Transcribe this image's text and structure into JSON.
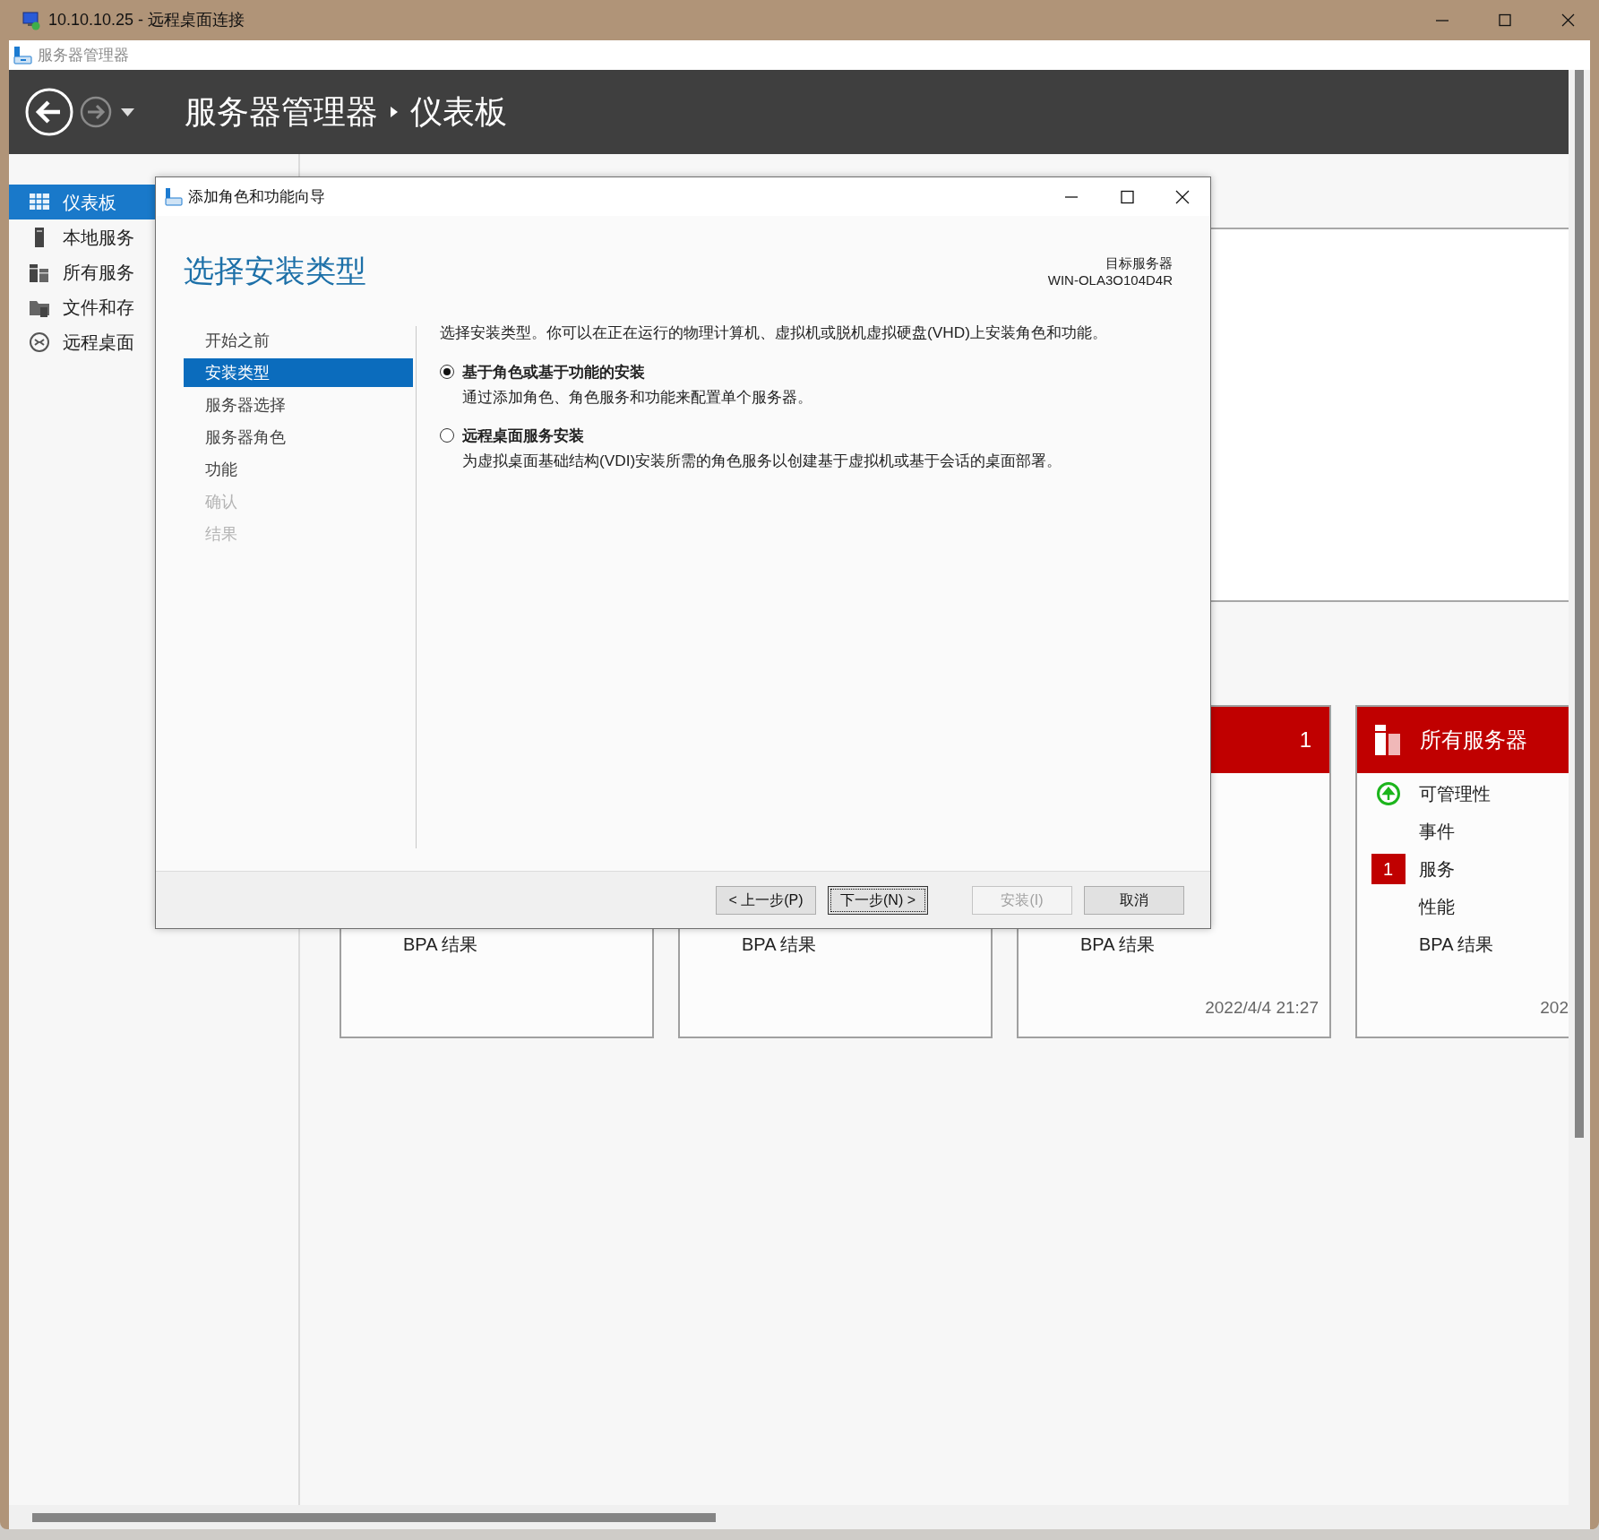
{
  "window": {
    "title": "10.10.10.25 - 远程桌面连接"
  },
  "app": {
    "title": "服务器管理器"
  },
  "header": {
    "breadcrumb": [
      "服务器管理器",
      "仪表板"
    ]
  },
  "nav": [
    {
      "label": "仪表板",
      "kind": "dashboard",
      "selected": true
    },
    {
      "label": "本地服务",
      "kind": "server",
      "selected": false
    },
    {
      "label": "所有服务",
      "kind": "servers",
      "selected": false
    },
    {
      "label": "文件和存",
      "kind": "storage",
      "selected": false
    },
    {
      "label": "远程桌面",
      "kind": "remote",
      "selected": false
    }
  ],
  "tiles": [
    {
      "bpa": "BPA 结果"
    },
    {
      "bpa": "BPA 结果"
    },
    {
      "count": "1",
      "bpa": "BPA 结果",
      "date": "2022/4/4 21:27"
    },
    {
      "title": "所有服务器",
      "rows": [
        {
          "label": "可管理性",
          "kind": "ok"
        },
        {
          "label": "事件",
          "kind": "plain"
        },
        {
          "label": "服务",
          "kind": "count",
          "count": "1"
        },
        {
          "label": "性能",
          "kind": "plain"
        }
      ],
      "bpa": "BPA 结果",
      "date": "202"
    }
  ],
  "dialog": {
    "title": "添加角色和功能向导",
    "heading": "选择安装类型",
    "target_label": "目标服务器",
    "target_server": "WIN-OLA3O104D4R",
    "steps": [
      {
        "label": "开始之前",
        "selected": false,
        "disabled": false
      },
      {
        "label": "安装类型",
        "selected": true,
        "disabled": false
      },
      {
        "label": "服务器选择",
        "selected": false,
        "disabled": false
      },
      {
        "label": "服务器角色",
        "selected": false,
        "disabled": false
      },
      {
        "label": "功能",
        "selected": false,
        "disabled": false
      },
      {
        "label": "确认",
        "selected": false,
        "disabled": true
      },
      {
        "label": "结果",
        "selected": false,
        "disabled": true
      }
    ],
    "description": "选择安装类型。你可以在正在运行的物理计算机、虚拟机或脱机虚拟硬盘(VHD)上安装角色和功能。",
    "options": [
      {
        "title": "基于角色或基于功能的安装",
        "description": "通过添加角色、角色服务和功能来配置单个服务器。",
        "selected": true
      },
      {
        "title": "远程桌面服务安装",
        "description": "为虚拟桌面基础结构(VDI)安装所需的角色服务以创建基于虚拟机或基于会话的桌面部署。",
        "selected": false
      }
    ],
    "buttons": [
      {
        "label": "< 上一步(P)",
        "disabled": false,
        "focused": false
      },
      {
        "label": "下一步(N) >",
        "disabled": false,
        "focused": true
      },
      {
        "label": "安装(I)",
        "disabled": true,
        "focused": false
      },
      {
        "label": "取消",
        "disabled": false,
        "focused": false
      }
    ]
  }
}
